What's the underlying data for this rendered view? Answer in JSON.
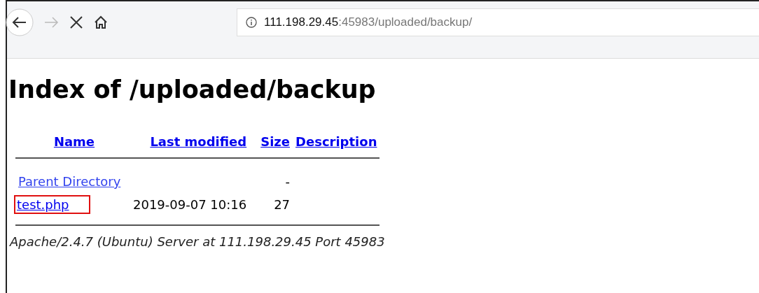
{
  "toolbar": {
    "back_enabled": true,
    "forward_enabled": false,
    "loading": true,
    "url_host": "111.198.29.45",
    "url_rest": ":45983/uploaded/backup/"
  },
  "title": "Index of /uploaded/backup",
  "table": {
    "columns": [
      "Name",
      "Last modified",
      "Size",
      "Description"
    ],
    "rows": [
      {
        "kind": "parent",
        "name": "Parent Directory",
        "modified": "",
        "size": "-",
        "highlighted": false
      },
      {
        "kind": "file",
        "name": "test.php",
        "modified": "2019-09-07 10:16",
        "size": "27",
        "highlighted": true
      }
    ]
  },
  "address": "Apache/2.4.7 (Ubuntu) Server at 111.198.29.45 Port 45983"
}
